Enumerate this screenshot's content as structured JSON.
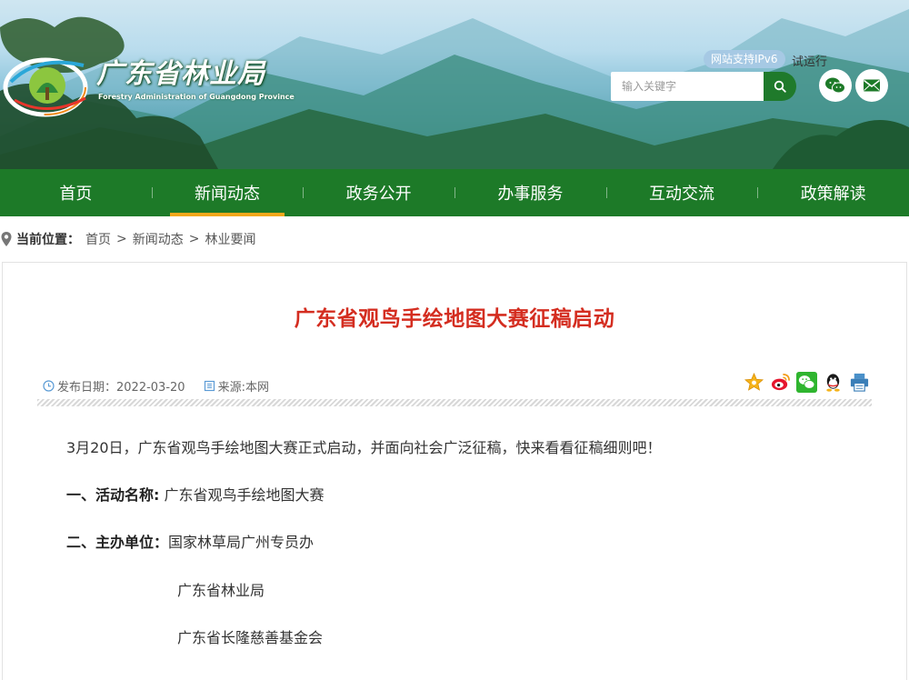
{
  "site": {
    "name_cn": "广东省林业局",
    "name_en": "Forestry Administration of Guangdong Province",
    "ipv6_badge": "网站支持IPv6",
    "trial_text": "试运行",
    "search_placeholder": "输入关键字"
  },
  "icons": {
    "search": "search-icon",
    "wechat": "wechat-icon",
    "mail": "mail-icon",
    "location": "map-pin-icon",
    "clock": "clock-icon",
    "source": "document-icon"
  },
  "colors": {
    "nav_bg": "#1d7a28",
    "nav_active": "#f2a81b",
    "title_red": "#d42d20"
  },
  "nav": {
    "items": [
      {
        "label": "首页"
      },
      {
        "label": "新闻动态"
      },
      {
        "label": "政务公开"
      },
      {
        "label": "办事服务"
      },
      {
        "label": "互动交流"
      },
      {
        "label": "政策解读"
      }
    ],
    "active_index": 1
  },
  "breadcrumb": {
    "title": "当前位置：",
    "items": [
      "首页",
      "新闻动态",
      "林业要闻"
    ],
    "separator": ">"
  },
  "article": {
    "title": "广东省观鸟手绘地图大赛征稿启动",
    "date_label": "发布日期：2022-03-20",
    "source_label": "来源:本网",
    "share": [
      "favorite-icon",
      "weibo-icon",
      "wechat-icon",
      "qq-icon",
      "print-icon"
    ],
    "paragraphs": {
      "intro": "3月20日，广东省观鸟手绘地图大赛正式启动，并面向社会广泛征稿，快来看看征稿细则吧！",
      "p1_label": "一、活动名称:",
      "p1_value": "广东省观鸟手绘地图大赛",
      "p2_label": "二、主办单位：",
      "p2_value": "国家林草局广州专员办",
      "p2_extra1": "广东省林业局",
      "p2_extra2": "广东省长隆慈善基金会"
    }
  }
}
